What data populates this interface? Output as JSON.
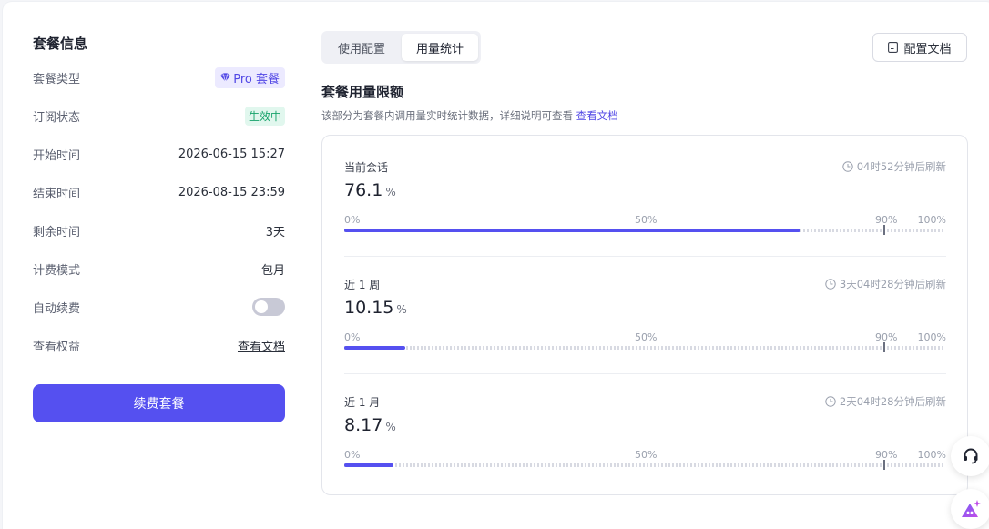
{
  "plan_info": {
    "title": "套餐信息",
    "rows": [
      {
        "label": "套餐类型",
        "value": "Pro 套餐"
      },
      {
        "label": "订阅状态",
        "value": "生效中"
      },
      {
        "label": "开始时间",
        "value": "2026-06-15 15:27"
      },
      {
        "label": "结束时间",
        "value": "2026-08-15 23:59"
      },
      {
        "label": "剩余时间",
        "value": "3天"
      },
      {
        "label": "计费模式",
        "value": "包月"
      },
      {
        "label": "自动续费",
        "value": ""
      },
      {
        "label": "查看权益",
        "value": "查看文档"
      }
    ],
    "auto_renew_on": false,
    "renew_button": "续费套餐"
  },
  "tabs": [
    {
      "label": "使用配置",
      "active": false
    },
    {
      "label": "用量统计",
      "active": true
    }
  ],
  "config_doc_button": "配置文档",
  "usage": {
    "title": "套餐用量限额",
    "description": "该部分为套餐内调用量实时统计数据，详细说明可查看",
    "description_link": "查看文档",
    "tick_labels": [
      "0%",
      "50%",
      "90%",
      "100%"
    ],
    "blocks": [
      {
        "name": "当前会话",
        "refresh": "04时52分钟后刷新",
        "value": "76.1",
        "unit": "%",
        "percent": 76.1
      },
      {
        "name": "近 1 周",
        "refresh": "3天04时28分钟后刷新",
        "value": "10.15",
        "unit": "%",
        "percent": 10.15
      },
      {
        "name": "近 1 月",
        "refresh": "2天04时28分钟后刷新",
        "value": "8.17",
        "unit": "%",
        "percent": 8.17
      }
    ]
  },
  "colors": {
    "accent": "#5550f0",
    "status_active": "#17a36b",
    "pro_badge_bg": "#eceaff"
  },
  "icons": {
    "pro_badge": "diamond-icon",
    "config_doc": "document-icon",
    "refresh": "clock-icon",
    "support": "headset-icon",
    "assistant": "ai-assistant-icon"
  }
}
